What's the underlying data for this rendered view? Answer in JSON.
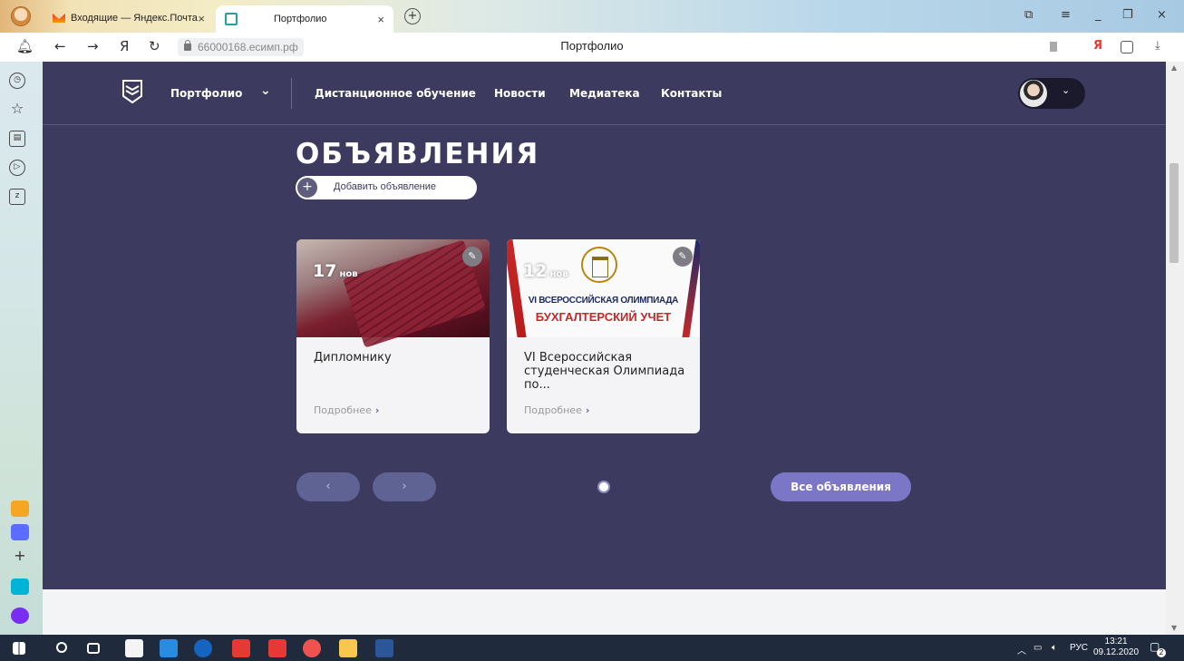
{
  "browser": {
    "tabs": [
      {
        "label": "Входящие — Яндекс.Почта",
        "close": "×"
      },
      {
        "label": "Портфолио",
        "close": "×"
      }
    ],
    "new_tab": "+",
    "window_controls": [
      "⧉",
      "≡",
      "_",
      "❐",
      "×"
    ],
    "nav": {
      "back": "←",
      "forward": "→",
      "yandex": "Я",
      "reload": "↻"
    },
    "url": "66000168.есимп.рф",
    "page_title": "Портфолио",
    "right_icons": [
      "bookmark-icon",
      "yandex-icon",
      "extensions-icon",
      "download-icon"
    ],
    "yandex_glyph": "Я",
    "download_glyph": "⤓",
    "sidebar_icons": [
      "alice-icon",
      "history-icon",
      "favorites-icon",
      "collections-icon",
      "video-icon",
      "zen-icon"
    ],
    "sidebar_apps": [
      {
        "name": "mail-app",
        "color": "#f5a623"
      },
      {
        "name": "messenger-app",
        "color": "#5b6cff"
      },
      {
        "name": "add-app",
        "color": "#cfe3d8"
      },
      {
        "name": "telemost-app",
        "color": "#00b4d8"
      },
      {
        "name": "alice-app",
        "color": "#7b2cf3"
      }
    ],
    "add_app_glyph": "+"
  },
  "site": {
    "nav": {
      "portfolio": "Портфолио",
      "portfolio_chevron": "⌄",
      "items": [
        "Дистанционное обучение",
        "Новости",
        "Медиатека",
        "Контакты"
      ],
      "user_chevron": "⌄"
    },
    "section_title": "ОБЪЯВЛЕНИЯ",
    "add_button": {
      "plus": "+",
      "label": "Добавить объявление"
    },
    "cards": [
      {
        "day": "17",
        "month": "нов",
        "image": "diploma-stack-photo",
        "title": "Дипломнику",
        "more": "Подробнее",
        "more_chevron": "›"
      },
      {
        "day": "12",
        "month": "нов",
        "image": "olympiad-banner",
        "image_text_line1": "VI ВСЕРОССИЙСКАЯ ОЛИМПИАДА",
        "image_text_line2": "БУХГАЛТЕРСКИЙ УЧЕТ",
        "title": "VI Всероссийская студенческая Олимпиада по...",
        "more": "Подробнее",
        "more_chevron": "›"
      }
    ],
    "edit_glyph": "✎",
    "pager": {
      "prev": "‹",
      "next": "›",
      "active_dot": 1
    },
    "all_button": "Все объявления",
    "colors": {
      "background": "#3c3b5f",
      "accent": "#7b77c6",
      "arrow_button": "#5e6394"
    }
  },
  "taskbar": {
    "apps": [
      "start-icon",
      "search-icon",
      "task-view-icon",
      "store-icon",
      "mail-icon",
      "edge-icon",
      "yandex-icon",
      "yandex-browser-icon",
      "yandex-other-icon",
      "explorer-icon",
      "word-icon"
    ],
    "language": "РУС",
    "time": "13:21",
    "date": "09.12.2020",
    "notification_count": "2"
  }
}
